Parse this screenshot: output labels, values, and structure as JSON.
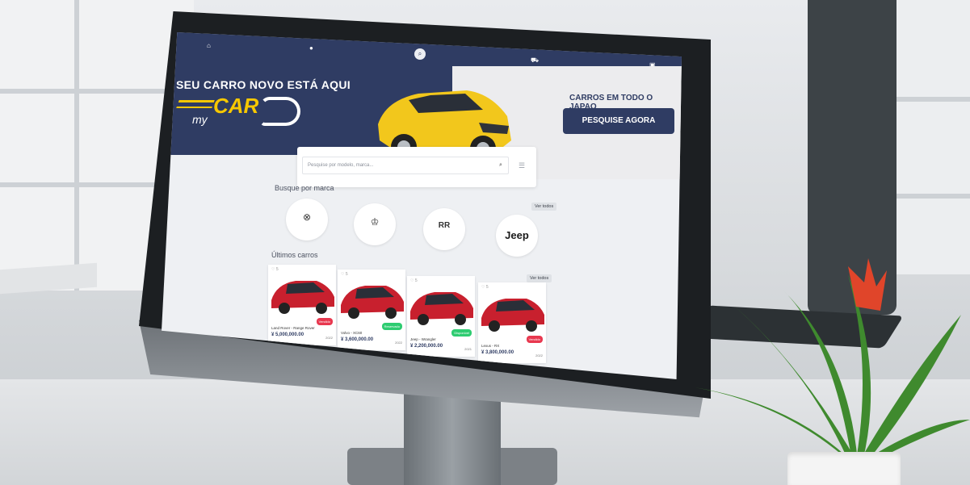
{
  "nav": {
    "icons": [
      "home-icon",
      "user-icon",
      "search-icon",
      "car-icon",
      "bookmark-icon"
    ]
  },
  "hero": {
    "tagline": "SEU CARRO NOVO ESTÁ AQUI",
    "logo_main": "CAR",
    "logo_sub": "my",
    "cta_text": "CARROS EM TODO O JAPAO",
    "cta_button": "PESQUISE AGORA"
  },
  "search": {
    "placeholder": "Pesquise por modelo, marca..."
  },
  "brands": {
    "title": "Busque por marca",
    "see_all": "Ver todos",
    "items": [
      {
        "name": "mazda",
        "glyph": "⊗"
      },
      {
        "name": "cadillac",
        "glyph": "♔"
      },
      {
        "name": "rolls-royce",
        "glyph": "RR"
      },
      {
        "name": "jeep",
        "glyph": "Jeep"
      }
    ]
  },
  "latest": {
    "title": "Últimos carros",
    "see_all": "Ver todos",
    "cards": [
      {
        "brand": "Land Rover - Range Rover",
        "price": "¥ 5,000,000.00",
        "year": "2022",
        "badge": "Vendido",
        "badge_color": "#e8384f",
        "likes": "5"
      },
      {
        "brand": "Volvo - XC60",
        "price": "¥ 3,600,000.00",
        "year": "2022",
        "badge": "Reservado",
        "badge_color": "#2ecc71",
        "likes": "5"
      },
      {
        "brand": "Jeep - Wrangler",
        "price": "¥ 2,200,000.00",
        "year": "2021",
        "badge": "Disponível",
        "badge_color": "#2ecc71",
        "likes": "5"
      },
      {
        "brand": "Lexus - RX",
        "price": "¥ 3,800,000.00",
        "year": "2022",
        "badge": "Vendido",
        "badge_color": "#e8384f",
        "likes": "5"
      }
    ]
  },
  "colors": {
    "primary": "#2f3c63",
    "accent": "#f7c800",
    "car_red": "#c8202e",
    "hero_car": "#f2c71c"
  }
}
